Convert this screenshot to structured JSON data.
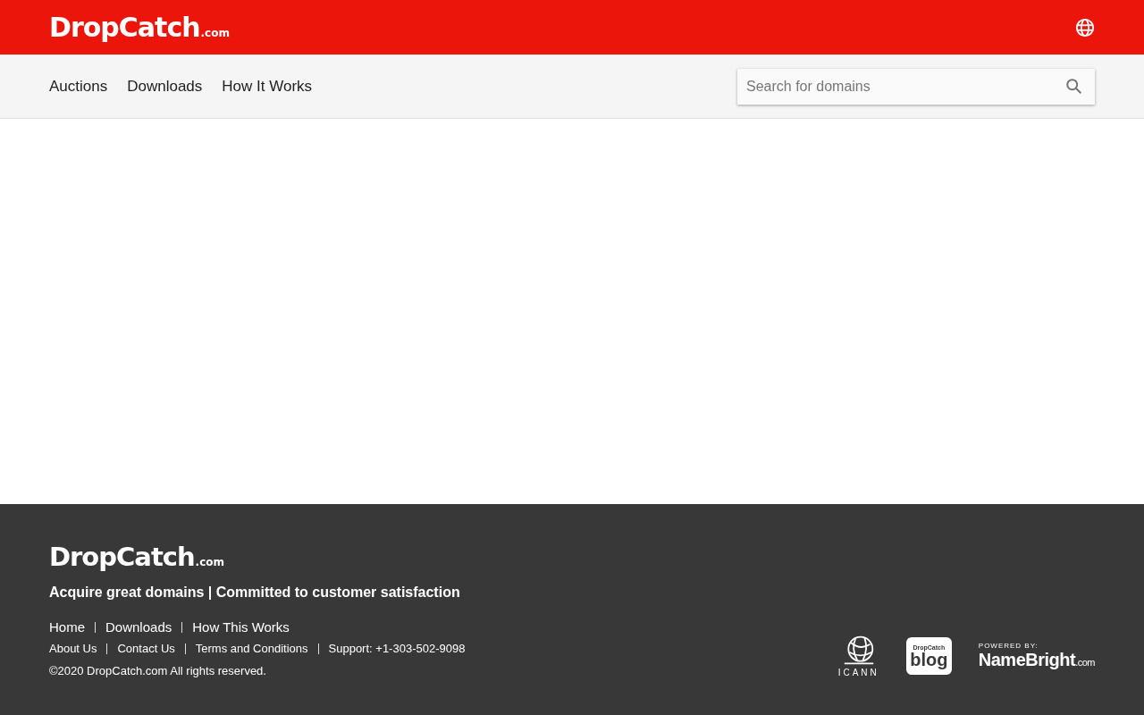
{
  "header": {
    "logo": {
      "name": "DropCatch",
      "suffix": ".com"
    }
  },
  "nav": {
    "links": [
      {
        "label": "Auctions"
      },
      {
        "label": "Downloads"
      },
      {
        "label": "How It Works"
      }
    ],
    "search": {
      "placeholder": "Search for domains"
    }
  },
  "footer": {
    "logo": {
      "name": "DropCatch",
      "suffix": ".com"
    },
    "tagline": "Acquire great domains | Committed to customer satisfaction",
    "primary_links": [
      "Home",
      "Downloads",
      "How This Works"
    ],
    "secondary_links": [
      "About Us",
      "Contact Us",
      "Terms and Conditions",
      "Support: +1-303-502-9098"
    ],
    "copyright": "©2020 DropCatch.com All rights reserved.",
    "badges": [
      {
        "kind": "icann",
        "text": "ICANN"
      },
      {
        "kind": "blog",
        "top": "DropCatch",
        "text": "blog"
      },
      {
        "kind": "powered",
        "top": "POWERED BY:",
        "text": "NameBright",
        "suffix": ".com"
      }
    ]
  }
}
